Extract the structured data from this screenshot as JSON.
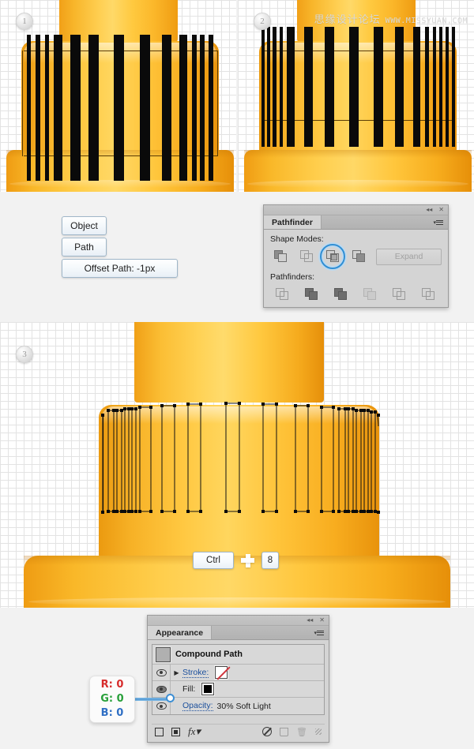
{
  "watermark": {
    "chinese": "思缘设计论坛",
    "english": "WWW.MISSYUAN.COM"
  },
  "steps": [
    {
      "id": "1",
      "label": "1"
    },
    {
      "id": "2",
      "label": "2"
    },
    {
      "id": "3",
      "label": "3"
    }
  ],
  "menu_trail": {
    "object_label": "Object",
    "path_label": "Path",
    "offset_label": "Offset Path: -1px"
  },
  "shortcut": {
    "modifier": "Ctrl",
    "plus": "+",
    "key": "8"
  },
  "pathfinder_panel": {
    "tab_label": "Pathfinder",
    "shape_modes_label": "Shape Modes:",
    "pathfinders_label": "Pathfinders:",
    "expand_label": "Expand",
    "shape_modes": [
      {
        "name": "unite",
        "selected": false
      },
      {
        "name": "minus-front",
        "selected": false
      },
      {
        "name": "intersect",
        "selected": true
      },
      {
        "name": "exclude",
        "selected": false
      }
    ],
    "pathfinders": [
      {
        "name": "divide"
      },
      {
        "name": "trim"
      },
      {
        "name": "merge"
      },
      {
        "name": "crop"
      },
      {
        "name": "outline"
      },
      {
        "name": "minus-back"
      }
    ],
    "collapse_icon": "◂◂",
    "close_icon": "✕",
    "selected_accent": "#2f8fd6"
  },
  "appearance_panel": {
    "tab_label": "Appearance",
    "object_title": "Compound Path",
    "rows": [
      {
        "name": "stroke",
        "label": "Stroke:",
        "value": "",
        "swatch": "none",
        "has_arrow": true,
        "visible": true
      },
      {
        "name": "fill",
        "label": "Fill:",
        "value": "",
        "swatch": "black",
        "has_arrow": false,
        "visible": true
      },
      {
        "name": "opacity",
        "label": "Opacity:",
        "value": "30% Soft Light",
        "swatch": "",
        "has_arrow": false,
        "visible": true
      }
    ],
    "footer_icons": [
      "add-new-stroke-icon",
      "add-new-fill-icon",
      "add-new-effect-icon",
      "clear-appearance-icon",
      "duplicate-item-icon",
      "delete-item-icon",
      "resize-grip-icon"
    ],
    "collapse_icon": "◂◂",
    "close_icon": "✕"
  },
  "rgb_callout": {
    "r_label": "R: 0",
    "g_label": "G: 0",
    "b_label": "B: 0",
    "r_color": "#d62b2b",
    "g_color": "#28a03a",
    "b_color": "#2f6fc4"
  },
  "artwork": {
    "description": "orange plastic bottle cap with vertical black ridge stripes",
    "base_color": "#ffc840",
    "shadow_color": "#ef9c13",
    "stripe_color": "#0a0a0a",
    "path_outline_color": "#5a3c05"
  }
}
